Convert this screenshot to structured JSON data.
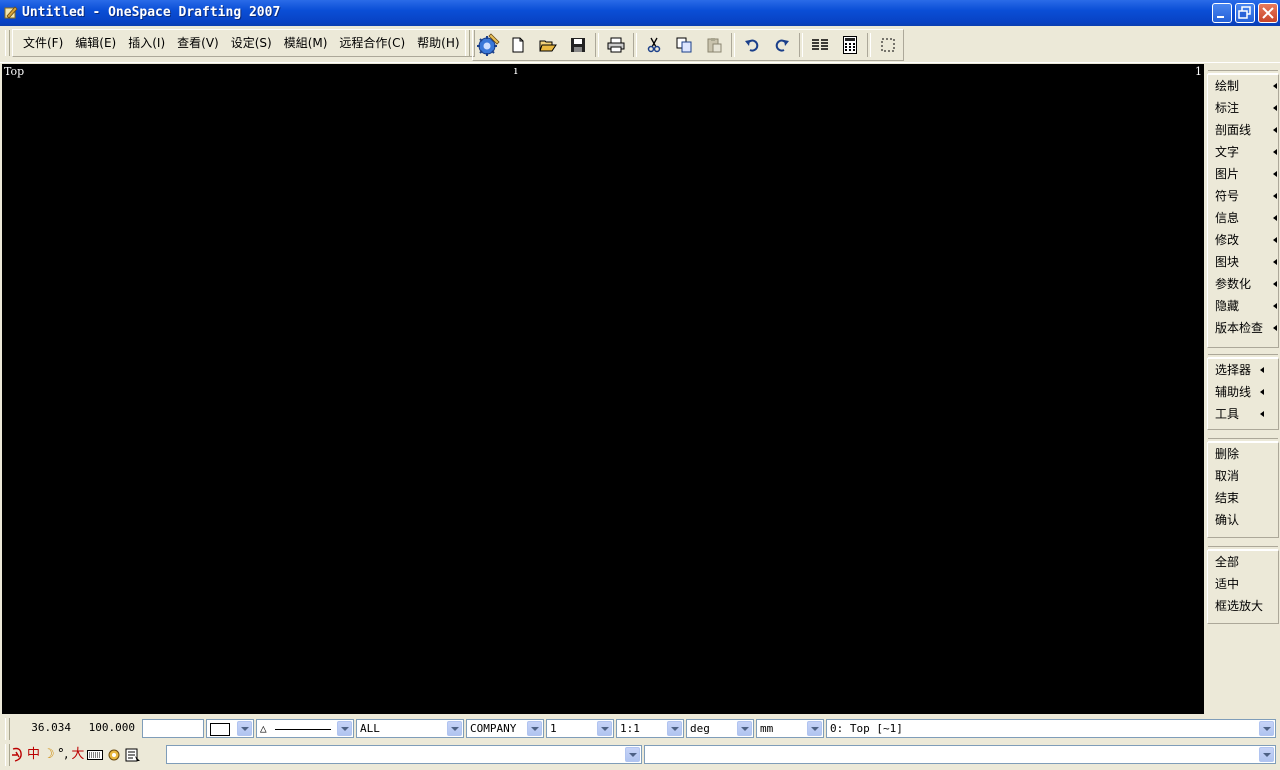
{
  "window": {
    "title": "Untitled - OneSpace Drafting 2007"
  },
  "menu": [
    {
      "label": "文件(F)"
    },
    {
      "label": "编辑(E)"
    },
    {
      "label": "插入(I)"
    },
    {
      "label": "查看(V)"
    },
    {
      "label": "设定(S)"
    },
    {
      "label": "模組(M)"
    },
    {
      "label": "远程合作(C)"
    },
    {
      "label": "帮助(H)"
    }
  ],
  "toolbar": {
    "icons": [
      "wizard-icon",
      "new-file-icon",
      "open-folder-icon",
      "save-icon",
      "print-icon",
      "cut-icon",
      "copy-icon",
      "paste-icon",
      "undo-icon",
      "redo-icon",
      "columns-icon",
      "calculator-icon",
      "select-box-icon"
    ]
  },
  "canvas": {
    "view_label": "Top",
    "view_number": "1",
    "top_mark": "ı",
    "background": "#000000"
  },
  "right_panel": {
    "group1": [
      "绘制",
      "标注",
      "剖面线",
      "文字",
      "图片",
      "符号",
      "信息",
      "修改",
      "图块",
      "参数化",
      "隐藏",
      "版本检查"
    ],
    "group2": [
      "选择器",
      "辅助线",
      "工具"
    ],
    "group3": [
      "删除",
      "取消",
      "结束",
      "确认"
    ],
    "group4": [
      "全部",
      "适中",
      "框选放大"
    ]
  },
  "status": {
    "coord_x": "36.034",
    "coord_y": "100.000",
    "linetype_symbol": "△",
    "layer": "ALL",
    "company": "COMPANY",
    "scale_value": "1",
    "ratio": "1:1",
    "angle_unit": "deg",
    "length_unit": "mm",
    "view_select": "0: Top [~1]"
  },
  "ime": {
    "mode_char": "中",
    "moon": "☽",
    "punct": "°,",
    "size": "大"
  }
}
